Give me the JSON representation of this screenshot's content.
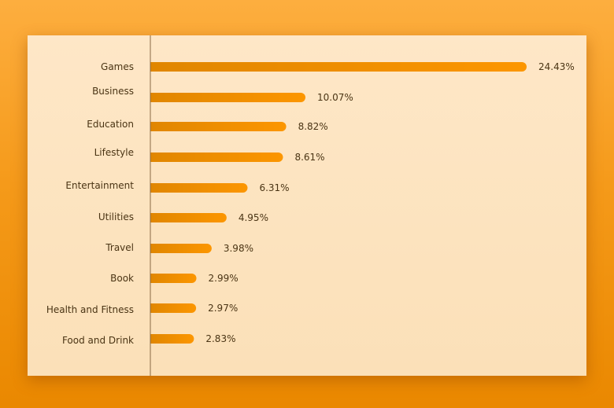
{
  "chart_data": {
    "type": "bar",
    "orientation": "horizontal",
    "title": "",
    "xlabel": "",
    "ylabel": "",
    "categories": [
      "Games",
      "Business",
      "Education",
      "Lifestyle",
      "Entertainment",
      "Utilities",
      "Travel",
      "Book",
      "Health and Fitness",
      "Food and Drink"
    ],
    "values": [
      24.43,
      10.07,
      8.82,
      8.61,
      6.31,
      4.95,
      3.98,
      2.99,
      2.97,
      2.83
    ],
    "value_labels": [
      "24.43%",
      "10.07%",
      "8.82%",
      "8.61%",
      "6.31%",
      "4.95%",
      "3.98%",
      "2.99%",
      "2.97%",
      "2.83%"
    ],
    "unit": "%",
    "xlim": [
      0,
      24.43
    ],
    "grid": false,
    "legend": "none"
  },
  "colors": {
    "bar_start": "#e08600",
    "bar_end": "#fc9600",
    "text": "#4a3414",
    "axis": "#8a6a45"
  }
}
